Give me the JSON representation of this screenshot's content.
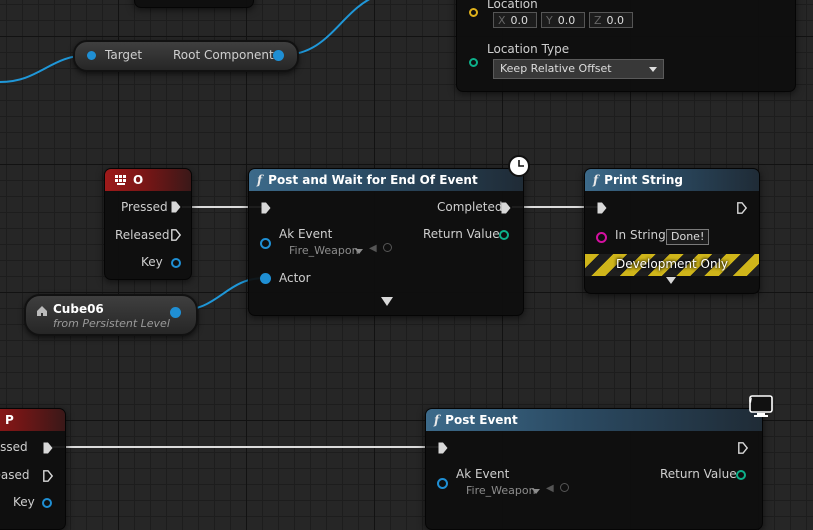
{
  "colors": {
    "exec_pin": "#d8d8d8",
    "object_pin": "#1f8fd4",
    "struct_pin": "#0db08a",
    "string_pin": "#d410a0",
    "vector_pin": "#e0b11b",
    "wire_object": "#1f97d8",
    "wire_exec": "#dcdcdc",
    "function_header": "#3c6a8a",
    "event_header": "#9e1a1a"
  },
  "target_node": {
    "target_label": "Target",
    "output_label": "Root Component"
  },
  "set_location_node": {
    "location_label": "Location",
    "x_axis": "X",
    "x_value": "0.0",
    "y_axis": "Y",
    "y_value": "0.0",
    "z_axis": "Z",
    "z_value": "0.0",
    "location_type_label": "Location Type",
    "location_type_value": "Keep Relative Offset"
  },
  "key_o_node": {
    "title": "O",
    "pressed": "Pressed",
    "released": "Released",
    "key": "Key"
  },
  "post_wait_node": {
    "title": "Post and Wait for End Of Event",
    "ak_event_label": "Ak Event",
    "ak_event_value": "Fire_Weapon",
    "actor_label": "Actor",
    "completed_label": "Completed",
    "return_label": "Return Value"
  },
  "print_string_node": {
    "title": "Print String",
    "in_string_label": "In String",
    "in_string_value": "Done!",
    "dev_only": "Development Only"
  },
  "cube_node": {
    "title": "Cube06",
    "subtitle": "from Persistent Level"
  },
  "key_p_node": {
    "title": "P",
    "pressed": "Pressed",
    "released": "Released",
    "key": "Key"
  },
  "post_event_node": {
    "title": "Post Event",
    "ak_event_label": "Ak Event",
    "ak_event_value": "Fire_Weapon",
    "return_label": "Return Value"
  },
  "icons": [
    "function-icon",
    "clock-icon",
    "keyboard-icon",
    "actor-reference-icon",
    "expand-arrow-icon",
    "monitor-icon",
    "dropdown-arrow-icon",
    "asset-browse-icon",
    "asset-search-icon"
  ]
}
